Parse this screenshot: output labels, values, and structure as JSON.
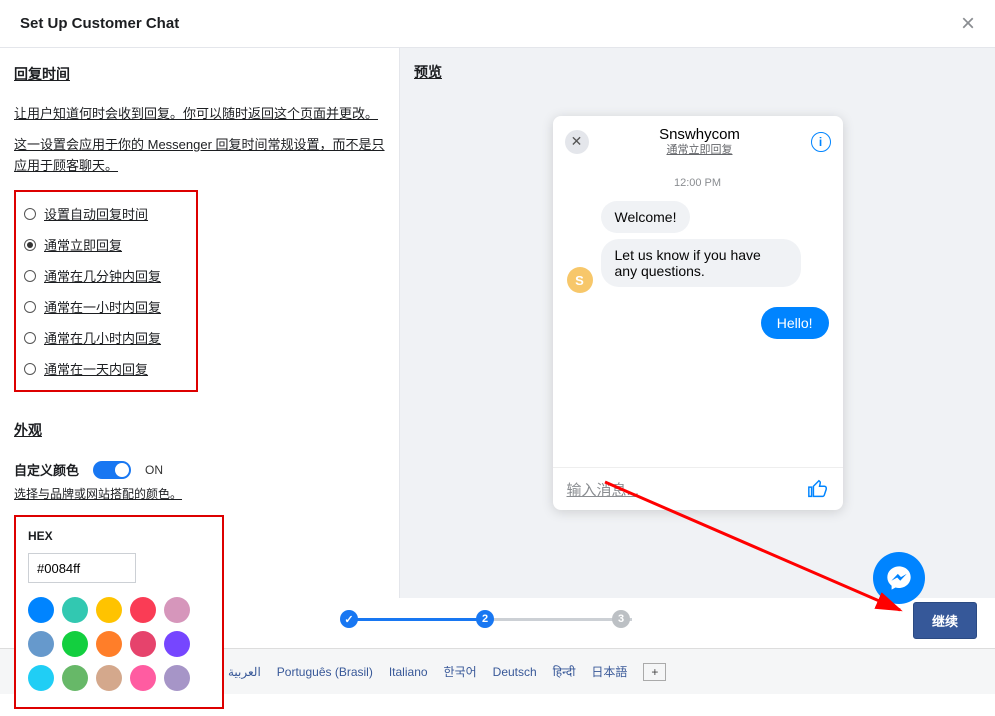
{
  "title": "Set Up Customer Chat",
  "left": {
    "section_reply": "回复时间",
    "desc1": "让用户知道何时会收到回复。你可以随时返回这个页面并更改。",
    "desc2": "这一设置会应用于你的 Messenger 回复时间常规设置，而不是只应用于顾客聊天。",
    "options": [
      "设置自动回复时间",
      "通常立即回复",
      "通常在几分钟内回复",
      "通常在一小时内回复",
      "通常在几小时内回复",
      "通常在一天内回复"
    ],
    "selected_index": 1,
    "section_appearance": "外观",
    "custom_color_label": "自定义颜色",
    "on_text": "ON",
    "custom_color_desc": "选择与品牌或网站搭配的颜色。",
    "color_value": "#0084ff"
  },
  "hex": {
    "label": "HEX",
    "value": "#0084ff",
    "swatches": [
      "#0084ff",
      "#32c8b1",
      "#ffc300",
      "#fa3c55",
      "#d696bb",
      "#6699cc",
      "#13cf3f",
      "#ff7e29",
      "#e6436c",
      "#7646ff",
      "#20cef5",
      "#67b868",
      "#d4a88c",
      "#ff5ca1",
      "#a695c7"
    ]
  },
  "preview": {
    "heading": "预览",
    "name": "Snswhycom",
    "sub": "通常立即回复",
    "time": "12:00 PM",
    "msg1": "Welcome!",
    "msg2": "Let us know if you have any questions.",
    "avatar_letter": "S",
    "msg_out": "Hello!",
    "placeholder": "输入消息..."
  },
  "steps": {
    "s2": "2",
    "s3": "3"
  },
  "continue_label": "继续",
  "languages": [
    "Português (Brasil)",
    "Italiano",
    "한국어",
    "Deutsch",
    "हिन्दी",
    "日本語"
  ],
  "lang_extra_left": "العربية"
}
